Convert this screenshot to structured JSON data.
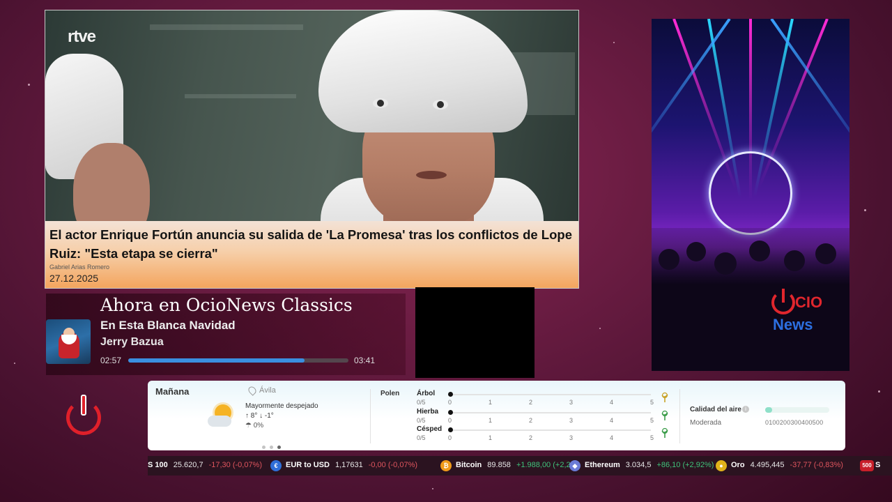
{
  "news": {
    "logo": "rtve",
    "headline": "El actor Enrique Fortún anuncia su salida de 'La Promesa' tras los conflictos de Lope Ruiz: \"Esta etapa se cierra\"",
    "author": "Gabriel Arias Romero",
    "date": "27.12.2025"
  },
  "now_playing": {
    "heading": "Ahora en OcioNews Classics",
    "title": "En Esta Blanca Navidad",
    "artist": "Jerry Bazua",
    "elapsed": "02:57",
    "total": "03:41",
    "progress": 0.8
  },
  "promo": {
    "logo_top": "CIO",
    "logo_bottom": "News"
  },
  "weather": {
    "day": "Mañana",
    "location": "Ávila",
    "description": "Mayormente despejado",
    "temps": "↑ 8°  ↓ -1°",
    "rain": "0%",
    "pollen_label": "Polen",
    "pollen": [
      {
        "name": "Árbol",
        "score": "0/5",
        "level": 0
      },
      {
        "name": "Hierba",
        "score": "0/5",
        "level": 0
      },
      {
        "name": "Césped",
        "score": "0/5",
        "level": 0
      }
    ],
    "scale_ticks": [
      "0",
      "1",
      "2",
      "3",
      "4",
      "5"
    ],
    "air_quality_label": "Calidad del aire",
    "air_quality_level": "Moderada",
    "air_quality_scale": "0100200300400500"
  },
  "ticker": {
    "items": [
      {
        "name": "S 100",
        "value": "25.620,7",
        "change": "-17,30 (-0,07%)",
        "dir": "neg"
      },
      {
        "name": "EUR to USD",
        "value": "1,17631",
        "change": "-0,00 (-0,07%)",
        "dir": "neg"
      },
      {
        "name": "Bitcoin",
        "value": "89.858",
        "change": "+1.988,00 (+2,2",
        "dir": "pos"
      },
      {
        "name": "Ethereum",
        "value": "3.034,5",
        "change": "+86,10 (+2,92%)",
        "dir": "pos"
      },
      {
        "name": "Oro",
        "value": "4.495,445",
        "change": "-37,77 (-0,83%)",
        "dir": "neg"
      },
      {
        "name": "S",
        "value": "",
        "change": "",
        "dir": "neg"
      }
    ],
    "last_badge": "500"
  },
  "colors": {
    "accent_red": "#e0202a",
    "progress_blue": "#3a8fe0",
    "ticker_pos": "#3fc27a",
    "ticker_neg": "#e0555e"
  }
}
